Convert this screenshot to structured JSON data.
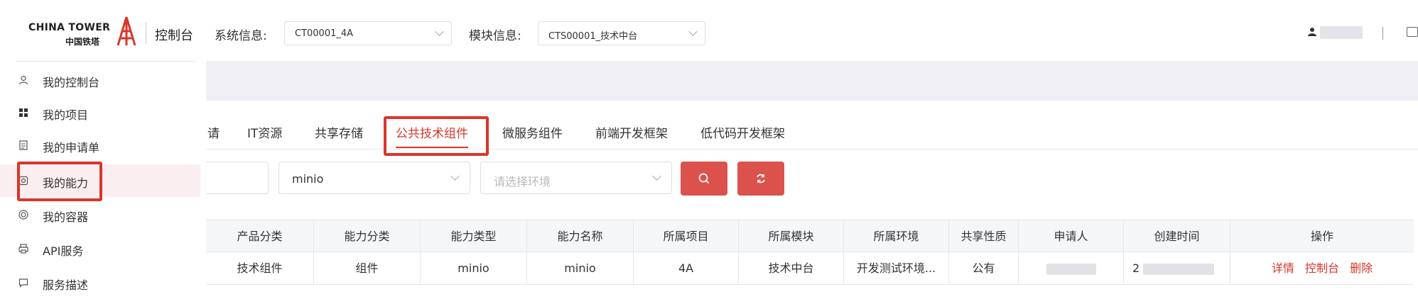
{
  "header": {
    "logo_en": "CHINA TOWER",
    "logo_cn": "中国铁塔",
    "console_title": "控制台",
    "system_label": "系统信息:",
    "system_value": "CT00001_4A",
    "module_label": "模块信息:",
    "module_value": "CTS00001_技术中台"
  },
  "sidebar": {
    "items": [
      {
        "label": "我的控制台",
        "icon": "user-icon"
      },
      {
        "label": "我的项目",
        "icon": "grid-icon"
      },
      {
        "label": "我的申请单",
        "icon": "document-icon"
      },
      {
        "label": "我的能力",
        "icon": "ability-icon"
      },
      {
        "label": "我的容器",
        "icon": "container-icon"
      },
      {
        "label": "API服务",
        "icon": "printer-icon"
      },
      {
        "label": "服务描述",
        "icon": "message-icon"
      }
    ]
  },
  "tabs": [
    {
      "label": "请"
    },
    {
      "label": "IT资源"
    },
    {
      "label": "共享存储"
    },
    {
      "label": "公共技术组件"
    },
    {
      "label": "微服务组件"
    },
    {
      "label": "前端开发框架"
    },
    {
      "label": "低代码开发框架"
    }
  ],
  "filters": {
    "component_value": "minio",
    "env_placeholder": "请选择环境"
  },
  "table": {
    "headers": [
      "产品分类",
      "能力分类",
      "能力类型",
      "能力名称",
      "所属项目",
      "所属模块",
      "所属环境",
      "共享性质",
      "申请人",
      "创建时间",
      "操作"
    ],
    "row": [
      "技术组件",
      "组件",
      "minio",
      "minio",
      "4A",
      "技术中台",
      "开发测试环境...",
      "公有",
      "",
      "2",
      ""
    ],
    "ops": [
      "详情",
      "控制台",
      "删除"
    ]
  },
  "colors": {
    "accent": "#d9362b",
    "button": "#db524d"
  }
}
